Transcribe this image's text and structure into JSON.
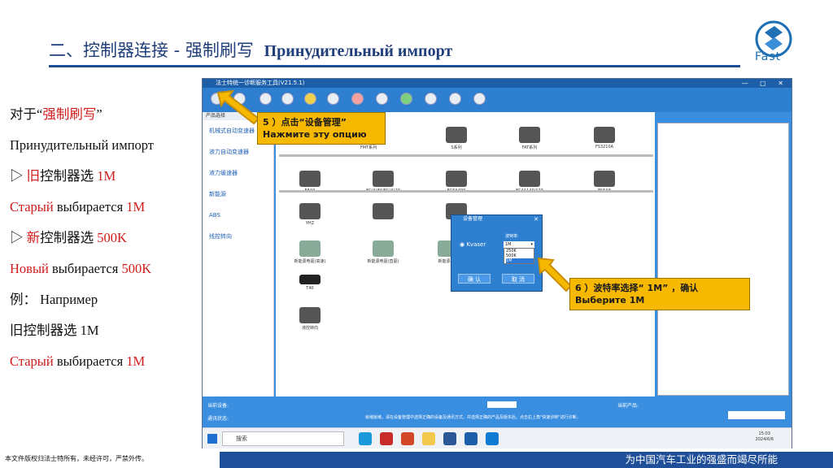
{
  "header": {
    "title_cn": "二、控制器连接 - 强制刷写",
    "title_ru": "Принудительный импорт",
    "logo_text": "Fast"
  },
  "left_text": [
    {
      "parts": [
        {
          "t": "对于“",
          "c": "black"
        },
        {
          "t": "强制刷写",
          "c": "red"
        },
        {
          "t": "”",
          "c": "black"
        }
      ]
    },
    {
      "parts": [
        {
          "t": "Принудительный импорт",
          "c": "black"
        }
      ]
    },
    {
      "parts": [
        {
          "t": "▷ ",
          "c": "black"
        },
        {
          "t": "旧",
          "c": "red"
        },
        {
          "t": "控制器选 ",
          "c": "black"
        },
        {
          "t": "1M",
          "c": "red"
        }
      ]
    },
    {
      "parts": [
        {
          "t": "Старый ",
          "c": "red"
        },
        {
          "t": "выбирается ",
          "c": "black"
        },
        {
          "t": "1M",
          "c": "red"
        }
      ]
    },
    {
      "parts": [
        {
          "t": "▷ ",
          "c": "black"
        },
        {
          "t": "新",
          "c": "red"
        },
        {
          "t": "控制器选 ",
          "c": "black"
        },
        {
          "t": "500K",
          "c": "red"
        }
      ]
    },
    {
      "parts": [
        {
          "t": "Новый ",
          "c": "red"
        },
        {
          "t": "выбирается ",
          "c": "black"
        },
        {
          "t": "500K",
          "c": "red"
        }
      ]
    },
    {
      "parts": [
        {
          "t": "例：    Например",
          "c": "black"
        }
      ]
    },
    {
      "parts": [
        {
          "t": "旧控制器选 1M",
          "c": "black"
        }
      ]
    },
    {
      "parts": [
        {
          "t": "Старый ",
          "c": "red"
        },
        {
          "t": "выбирается ",
          "c": "black"
        },
        {
          "t": "1M",
          "c": "red"
        }
      ]
    }
  ],
  "screenshot": {
    "window_title": "法士特统一诊断服务工具(V21.5.1)",
    "sidebar_head": "产品选择",
    "sidebar_items": [
      "机械式自动变速器",
      "液力自动变速器",
      "液力缓速器",
      "新能源",
      "ABS",
      "线控转向"
    ],
    "parts_row1": [
      "FMT系列",
      "FMT系列",
      "S系列",
      "FAT系列",
      "FS3210A"
    ],
    "parts_row2": [
      "F8A9",
      "FC(A)80/FC(A)20",
      "FC6A400",
      "FC4A140/120",
      "FS6A8"
    ],
    "parts_row3": [
      "YHZ",
      "",
      ""
    ],
    "parts_row4": [
      "新能源电驱(高速)",
      "新能源电驱(直驱)",
      "新能源电驱"
    ],
    "parts_row5": [
      "T40"
    ],
    "parts_row6": [
      "液控转向"
    ],
    "status_device_label": "当前设备:",
    "status_product_label": "当前产品:",
    "status_comm_label": "通讯状态:",
    "status_message": "就绪就绪，请在设备管理中选择正确的设备及通讯方式，并选择正确的产品及版本后，点击右上角\"快速诊断\"进行诊断。",
    "taskbar_search": "搜索",
    "clock_time": "15:03",
    "clock_date": "2024/6/6"
  },
  "dialog": {
    "title": "设备管理",
    "radio_label": "Kvaser",
    "baud_label": "波特率:",
    "baud_selected": "1M",
    "baud_options": [
      "250K",
      "500K",
      "1M"
    ],
    "ok_label": "确 认",
    "cancel_label": "取 消"
  },
  "callouts": {
    "step5_cn": "5 ）点击“设备管理”",
    "step5_ru": "Нажмите эту опцию",
    "step6_cn": "6 ）波特率选择“ 1M” ，确认",
    "step6_ru": "Выберите 1M"
  },
  "footer": {
    "copyright": "本文件版权归法士特所有，未经许可，严禁外传。",
    "slogan": "为中国汽车工业的强盛而竭尽所能"
  }
}
